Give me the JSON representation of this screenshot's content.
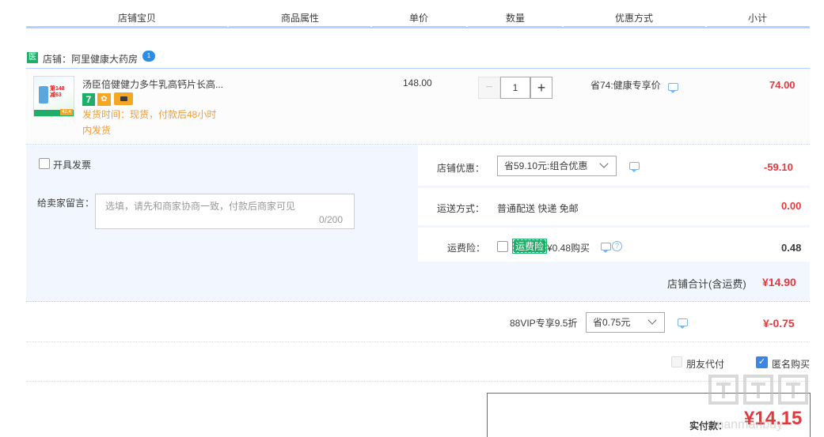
{
  "header": {
    "columns": [
      "店铺宝贝",
      "商品属性",
      "单价",
      "数量",
      "优惠方式",
      "小计"
    ]
  },
  "shop": {
    "icon": "medicine-shop-icon",
    "icon_char": "医",
    "name": "店铺：阿里健康大药房",
    "badge": "1"
  },
  "item": {
    "title": "汤臣倍健健力多牛乳高钙片长高...",
    "thumb_text": "第148\n减63",
    "thumb_tag": "42.4",
    "badge_7": "7",
    "ship_time": "发货时间：现货，付款后48小时内发货",
    "unit_price": "148.00",
    "quantity": "1",
    "minus": "−",
    "plus": "+",
    "promo": "省74:健康专享价",
    "subtotal": "74.00"
  },
  "order": {
    "invoice_label": "开具发票",
    "message_label": "给卖家留言：",
    "message_placeholder": "选填，请先和商家协商一致，付款后商家可见",
    "message_count": "0/200",
    "shop_discount_label": "店铺优惠：",
    "shop_discount_value": "省59.10元:组合优惠",
    "shop_discount_amount": "-59.10",
    "shipping_label": "运送方式：",
    "shipping_value": "普通配送 快递 免邮",
    "shipping_amount": "0.00",
    "insurance_label": "运费险：",
    "insurance_tag": "运费险",
    "insurance_price": "¥0.48购买",
    "insurance_amount": "0.48",
    "shop_total_label": "店铺合计(含运费)",
    "shop_total": "¥14.90"
  },
  "vip": {
    "label": "88VIP专享9.5折",
    "select": "省0.75元",
    "amount": "¥-0.75"
  },
  "options": {
    "friend_pay": "朋友代付",
    "anonymous": "匿名购买",
    "check": "✓"
  },
  "pay": {
    "label": "实付款：",
    "amount": "¥14.15"
  },
  "colors": {
    "accent_red": "#e4393c",
    "header_line": "#b2d1ff",
    "panel_bg": "#f2f7ff",
    "green": "#1fae6a"
  }
}
